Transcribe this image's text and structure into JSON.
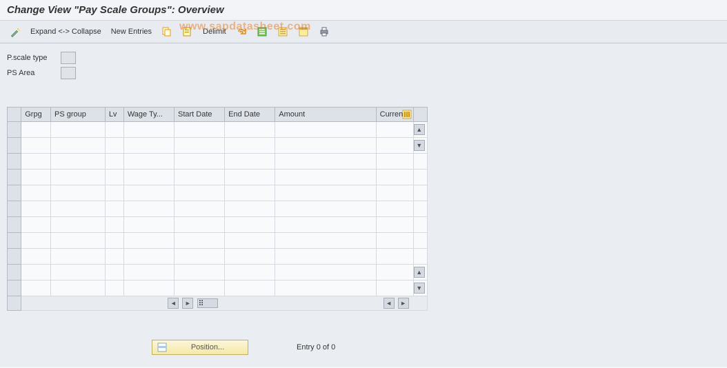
{
  "title": "Change View \"Pay Scale Groups\": Overview",
  "watermark": "www.sapdatasheet.com",
  "toolbar": {
    "expand_collapse": "Expand <-> Collapse",
    "new_entries": "New Entries",
    "delimit": "Delimit"
  },
  "fields": {
    "pscale_type_label": "P.scale type",
    "pscale_type_value": "",
    "ps_area_label": "PS Area",
    "ps_area_value": ""
  },
  "table": {
    "columns": [
      "Grpg",
      "PS group",
      "Lv",
      "Wage Ty...",
      "Start Date",
      "End Date",
      "Amount",
      "Curren"
    ],
    "rows": [
      [
        "",
        "",
        "",
        "",
        "",
        "",
        "",
        ""
      ],
      [
        "",
        "",
        "",
        "",
        "",
        "",
        "",
        ""
      ],
      [
        "",
        "",
        "",
        "",
        "",
        "",
        "",
        ""
      ],
      [
        "",
        "",
        "",
        "",
        "",
        "",
        "",
        ""
      ],
      [
        "",
        "",
        "",
        "",
        "",
        "",
        "",
        ""
      ],
      [
        "",
        "",
        "",
        "",
        "",
        "",
        "",
        ""
      ],
      [
        "",
        "",
        "",
        "",
        "",
        "",
        "",
        ""
      ],
      [
        "",
        "",
        "",
        "",
        "",
        "",
        "",
        ""
      ],
      [
        "",
        "",
        "",
        "",
        "",
        "",
        "",
        ""
      ],
      [
        "",
        "",
        "",
        "",
        "",
        "",
        "",
        ""
      ],
      [
        "",
        "",
        "",
        "",
        "",
        "",
        "",
        ""
      ]
    ]
  },
  "footer": {
    "position_label": "Position...",
    "entry_text": "Entry 0 of 0"
  }
}
